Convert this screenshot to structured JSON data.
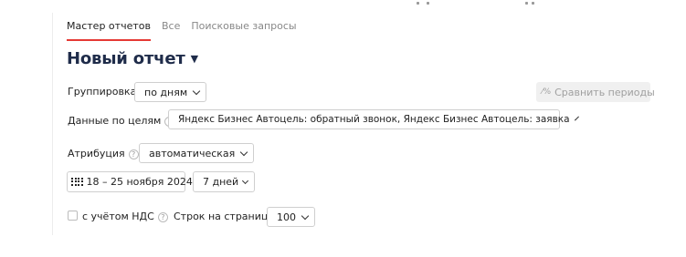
{
  "tabs": [
    {
      "label": "Мастер отчетов",
      "active": true
    },
    {
      "label": "Все",
      "active": false
    },
    {
      "label": "Поисковые запросы",
      "active": false
    }
  ],
  "report": {
    "title": "Новый отчет",
    "title_caret": "▼"
  },
  "grouping": {
    "label": "Группировка",
    "value": "по дням"
  },
  "compare": {
    "label": "Сравнить периоды",
    "icon": "compare-icon",
    "enabled": false
  },
  "goals": {
    "label": "Данные по целям",
    "value": "Яндекс Бизнес Автоцель: обратный звонок, Яндекс Бизнес Автоцель: заявка"
  },
  "attribution": {
    "label": "Атрибуция",
    "value": "автоматическая"
  },
  "period": {
    "dates": "18 – 25 ноября 2024",
    "preset": "7 дней"
  },
  "vat": {
    "label": "с учётом НДС",
    "checked": false
  },
  "rows": {
    "label": "Строк на странице",
    "value": "100"
  },
  "help_glyph": "?",
  "colors": {
    "accent": "#e53935",
    "title": "#1f2c4a",
    "disabled_bg": "#f0f0f0"
  }
}
